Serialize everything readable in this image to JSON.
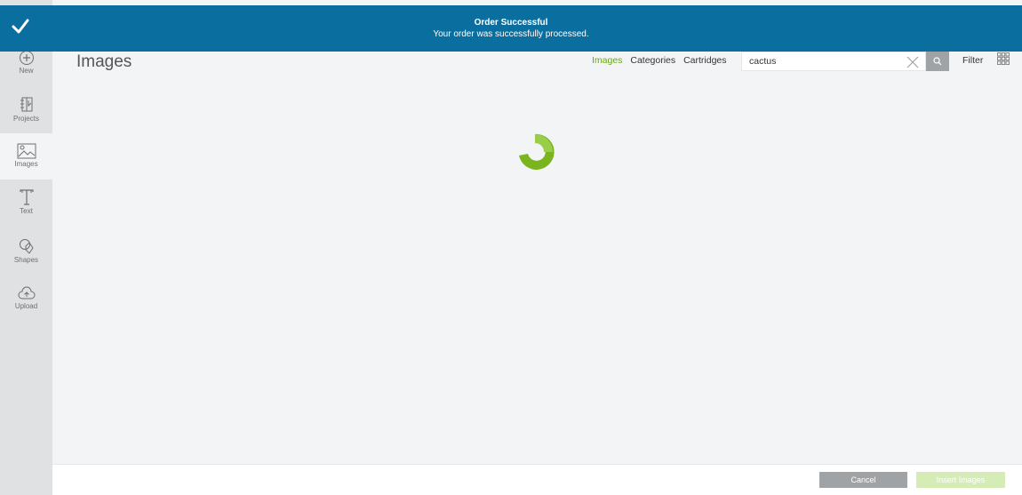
{
  "notification": {
    "title": "Order Successful",
    "message": "Your order was successfully processed.",
    "color": "#0a6f9f"
  },
  "sidebar": {
    "items": [
      {
        "label": "New",
        "icon": "plus-circle-icon"
      },
      {
        "label": "Projects",
        "icon": "projects-icon"
      },
      {
        "label": "Images",
        "icon": "image-icon",
        "active": true
      },
      {
        "label": "Text",
        "icon": "text-icon"
      },
      {
        "label": "Shapes",
        "icon": "shapes-icon"
      },
      {
        "label": "Upload",
        "icon": "upload-cloud-icon"
      }
    ]
  },
  "header": {
    "title": "Images",
    "tabs": [
      {
        "label": "Images",
        "active": true
      },
      {
        "label": "Categories"
      },
      {
        "label": "Cartridges"
      }
    ],
    "search": {
      "value": "cactus"
    },
    "filter_label": "Filter"
  },
  "footer": {
    "cancel_label": "Cancel",
    "insert_label": "Insert Images"
  },
  "colors": {
    "accent": "#6aa51c",
    "sidebar_bg": "#e0e1e3",
    "content_bg": "#f3f4f6"
  }
}
